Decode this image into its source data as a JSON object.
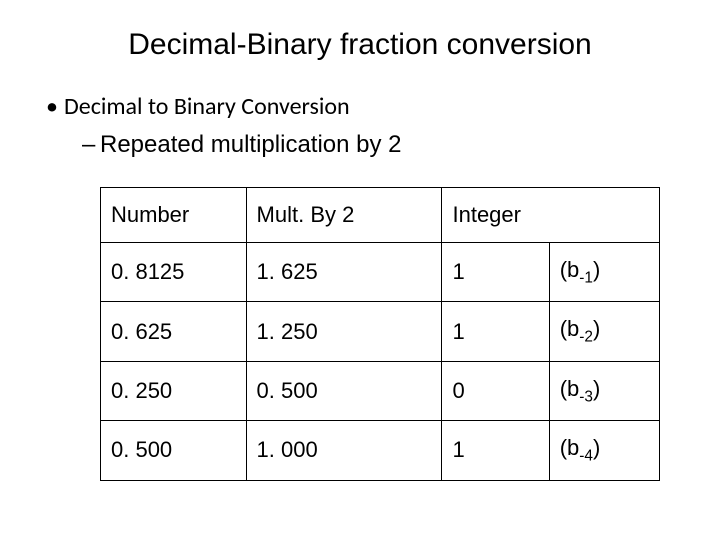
{
  "title": "Decimal-Binary fraction conversion",
  "bullet1": "Decimal to Binary Conversion",
  "bullet2": "Repeated multiplication by 2",
  "headers": {
    "number": "Number",
    "mult": "Mult. By 2",
    "integer": "Integer"
  },
  "rows": [
    {
      "number": "0. 8125",
      "mult": "1. 625",
      "int": "1",
      "b_prefix": "(b",
      "b_sub": "-1",
      "b_suffix": ")"
    },
    {
      "number": "0. 625",
      "mult": "1. 250",
      "int": "1",
      "b_prefix": "(b",
      "b_sub": "-2",
      "b_suffix": ")"
    },
    {
      "number": "0. 250",
      "mult": "0. 500",
      "int": "0",
      "b_prefix": "(b",
      "b_sub": "-3",
      "b_suffix": ")"
    },
    {
      "number": "0. 500",
      "mult": "1. 000",
      "int": "1",
      "b_prefix": "(b",
      "b_sub": "-4",
      "b_suffix": ")"
    }
  ]
}
